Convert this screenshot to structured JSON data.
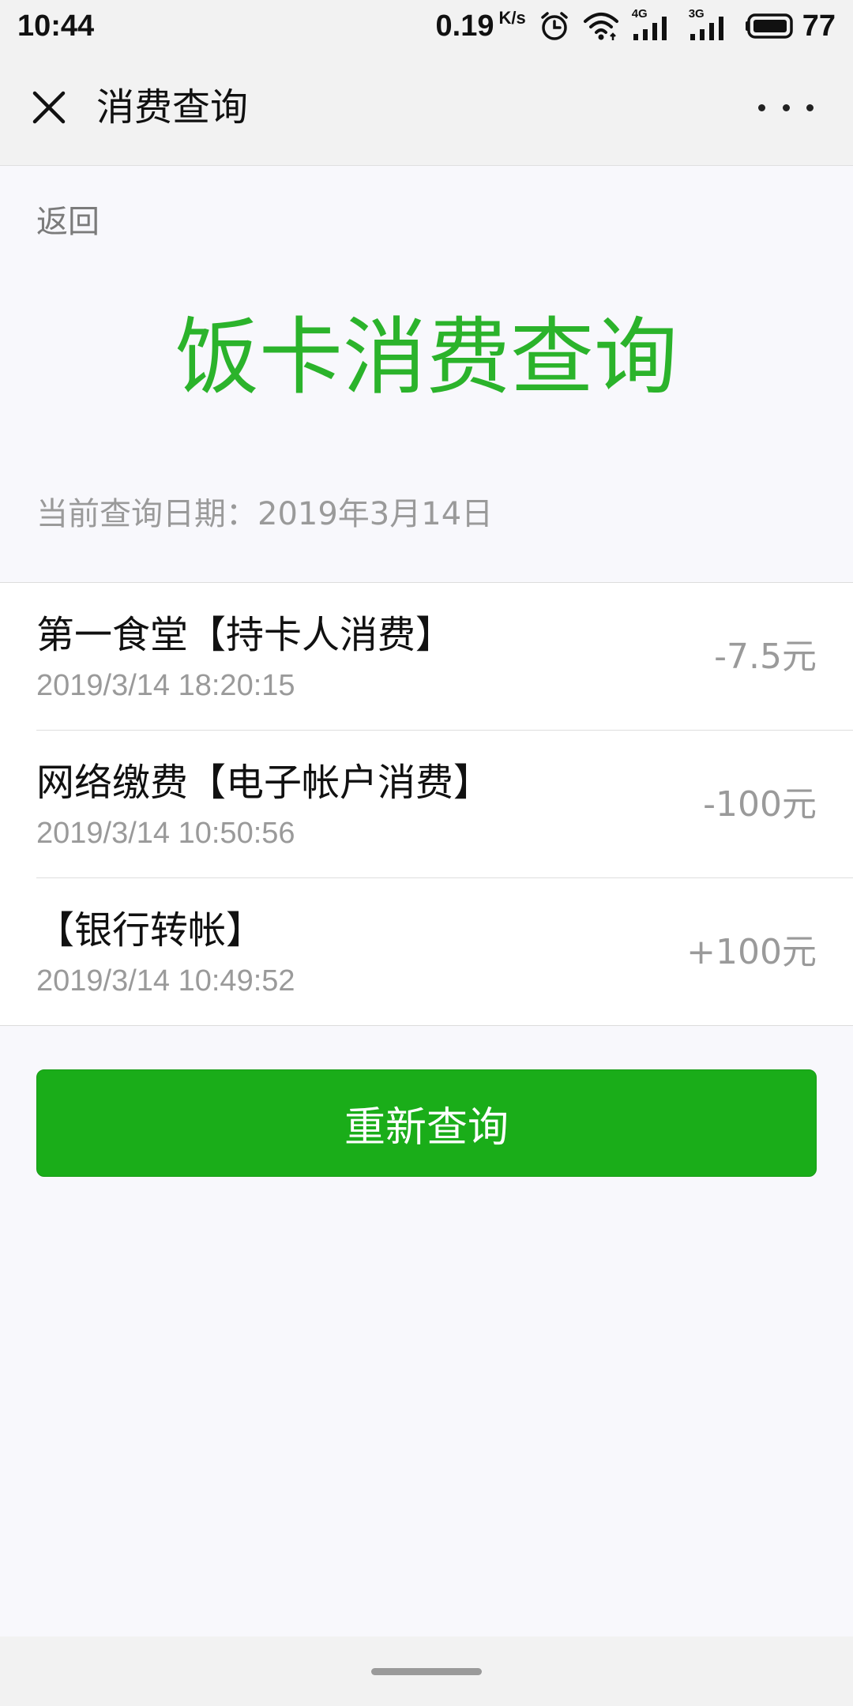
{
  "status_bar": {
    "time": "10:44",
    "net_speed": "0.19",
    "net_speed_unit": "K/s",
    "signal_1_label": "4G",
    "signal_2_label": "3G",
    "battery": "77",
    "icons": [
      "alarm-icon",
      "wifi-icon",
      "signal-4g-icon",
      "signal-3g-icon",
      "battery-icon"
    ]
  },
  "title_bar": {
    "title": "消费查询",
    "close_icon": "close-icon",
    "more_icon": "more-icon"
  },
  "content": {
    "back_label": "返回",
    "heading": "饭卡消费查询",
    "query_date_label": "当前查询日期：",
    "query_date_value": "2019年3月14日"
  },
  "records": [
    {
      "title": "第一食堂【持卡人消费】",
      "time": "2019/3/14 18:20:15",
      "amount": "-7.5元"
    },
    {
      "title": "网络缴费【电子帐户消费】",
      "time": "2019/3/14 10:50:56",
      "amount": "-100元"
    },
    {
      "title": "【银行转帐】",
      "time": "2019/3/14 10:49:52",
      "amount": "+100元"
    }
  ],
  "actions": {
    "requery_label": "重新查询"
  },
  "colors": {
    "heading_green": "#2bb32b",
    "button_green": "#1aad19",
    "secondary_text": "#9a9a9a",
    "page_background": "#f8f8fc",
    "bar_background": "#f2f2f2"
  }
}
